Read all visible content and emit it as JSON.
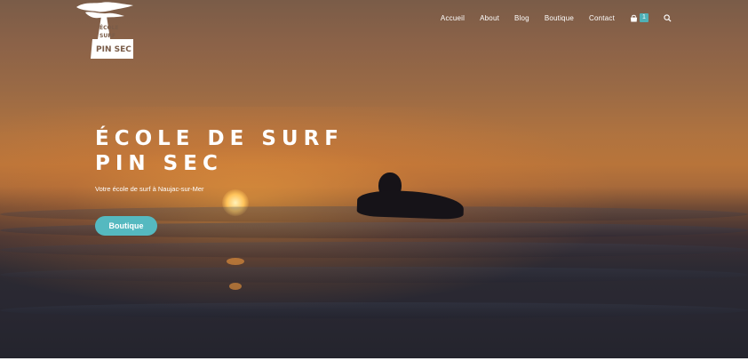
{
  "header": {
    "logo_name": "tree-logo",
    "logo_text": [
      "ÉCOLE",
      "SURF",
      "PIN SEC"
    ]
  },
  "nav": {
    "items": [
      {
        "label": "Accueil"
      },
      {
        "label": "About"
      },
      {
        "label": "Blog"
      },
      {
        "label": "Boutique"
      },
      {
        "label": "Contact"
      }
    ],
    "cart_icon": "shopping-bag-icon",
    "cart_count": "1",
    "search_icon": "search-icon"
  },
  "hero": {
    "title_line1": "ÉCOLE DE SURF",
    "title_line2": "PIN SEC",
    "subtitle": "Votre école de surf à Naujac-sur-Mer",
    "cta_label": "Boutique"
  },
  "colors": {
    "accent": "#55b9c0",
    "text": "#ffffff"
  }
}
